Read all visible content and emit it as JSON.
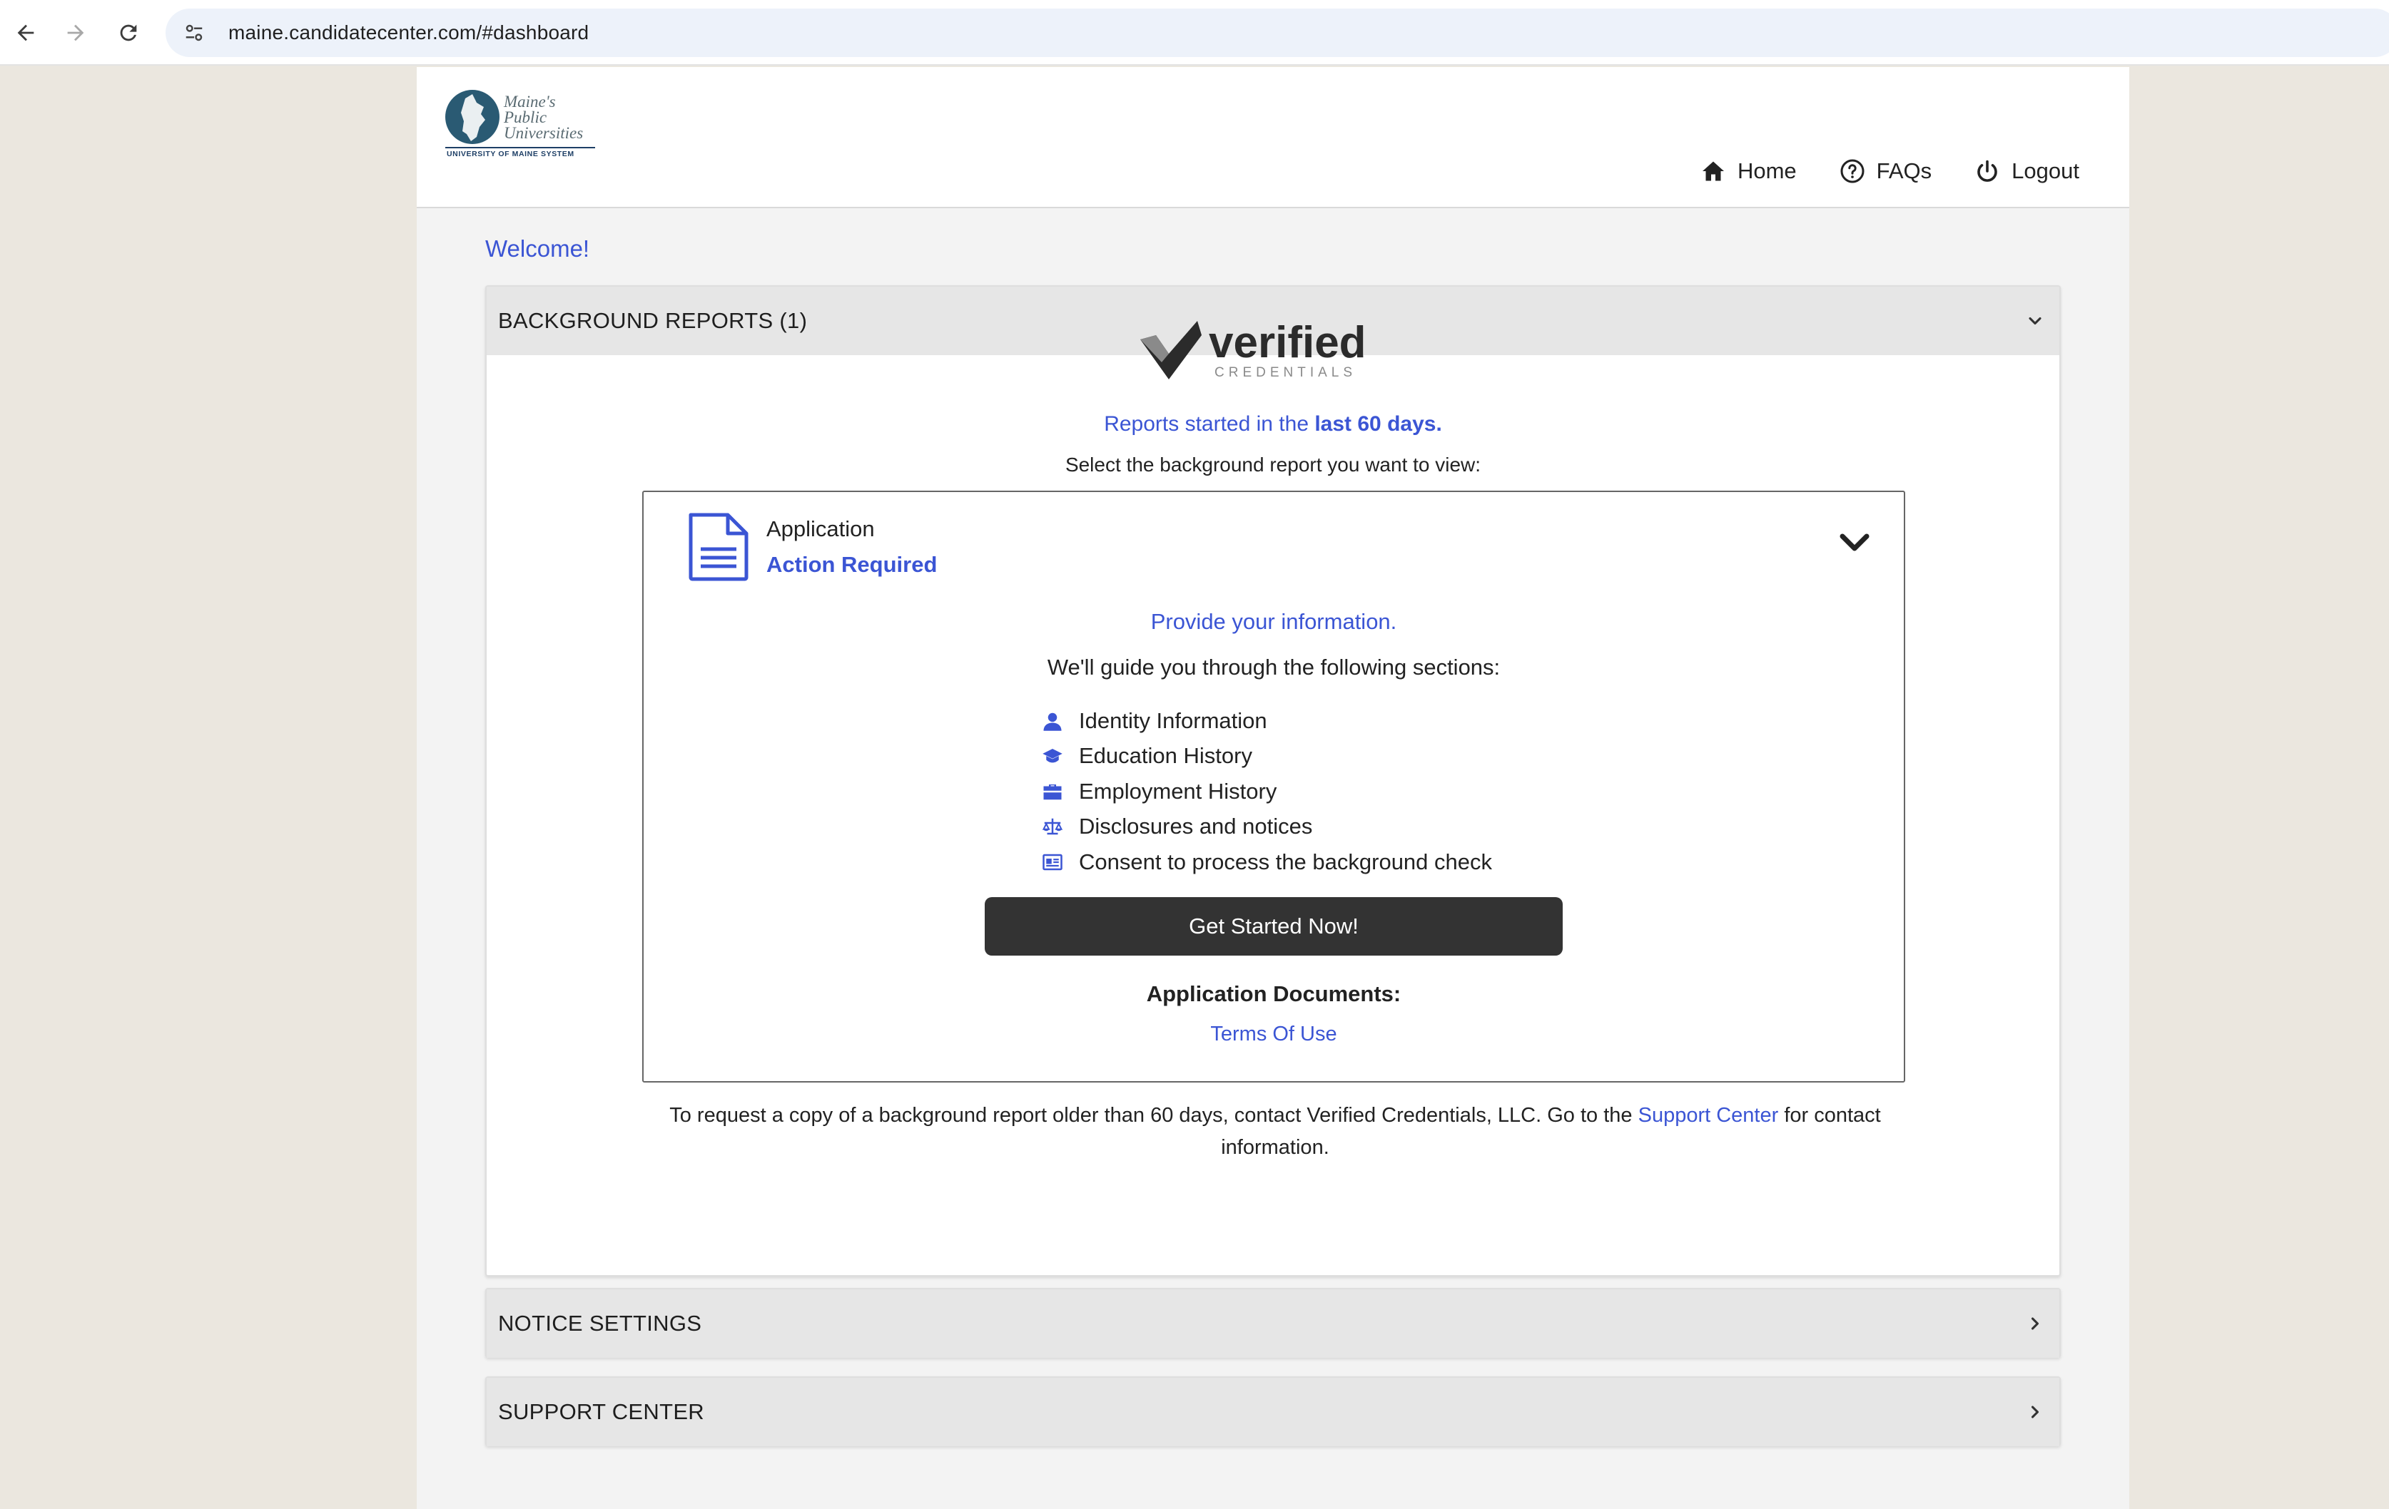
{
  "browser": {
    "url": "maine.candidatecenter.com/#dashboard"
  },
  "header": {
    "logo": {
      "line1": "Maine's",
      "line2": "Public",
      "line3": "Universities",
      "subtitle": "UNIVERSITY OF MAINE SYSTEM"
    },
    "nav": [
      {
        "label": "Home",
        "icon": "home-icon"
      },
      {
        "label": "FAQs",
        "icon": "question-circle-icon"
      },
      {
        "label": "Logout",
        "icon": "power-icon"
      }
    ]
  },
  "welcome": "Welcome!",
  "background_reports": {
    "title": "BACKGROUND REPORTS (1)",
    "vendor_logo": {
      "word": "verified",
      "subword": "CREDENTIALS"
    },
    "reports_prefix": "Reports started in the ",
    "reports_emphasis": "last 60 days.",
    "select_prompt": "Select the background report you want to view:",
    "application": {
      "title": "Application",
      "status": "Action Required",
      "provide": "Provide your information.",
      "guide": "We'll guide you through the following sections:",
      "sections": [
        {
          "label": "Identity Information",
          "icon": "person-icon"
        },
        {
          "label": "Education History",
          "icon": "graduation-cap-icon"
        },
        {
          "label": "Employment History",
          "icon": "briefcase-icon"
        },
        {
          "label": "Disclosures and notices",
          "icon": "balance-scale-icon"
        },
        {
          "label": "Consent to process the background check",
          "icon": "id-card-icon"
        }
      ],
      "cta": "Get Started Now!",
      "docs_title": "Application Documents:",
      "terms_link": "Terms Of Use"
    },
    "footnote": {
      "before": "To request a copy of a background report older than 60 days, contact Verified Credentials, LLC. Go to the ",
      "link": "Support Center",
      "after": " for contact information."
    }
  },
  "notice_settings": {
    "title": "NOTICE SETTINGS"
  },
  "support_center": {
    "title": "SUPPORT CENTER"
  },
  "colors": {
    "accent": "#3b55d4",
    "button_dark": "#333333",
    "panel_header": "#e6e6e6",
    "page_bg": "#ebe7df"
  }
}
